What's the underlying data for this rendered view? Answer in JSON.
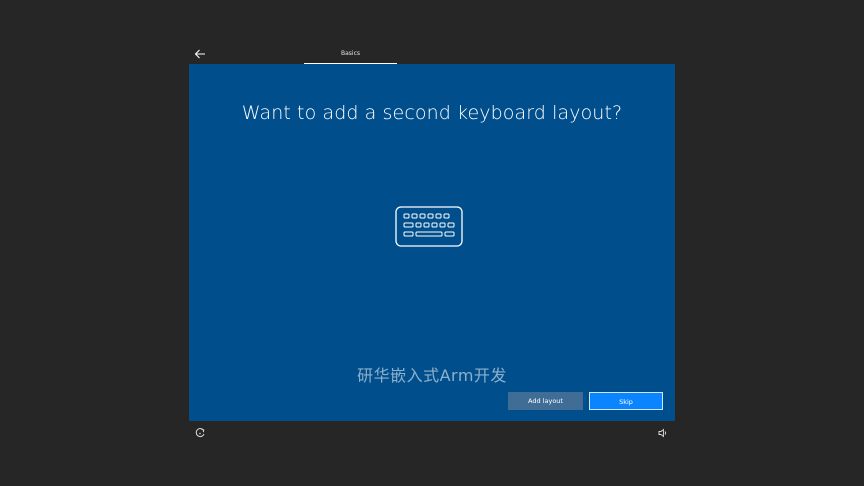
{
  "header": {
    "step_label": "Basics"
  },
  "main": {
    "title": "Want to add a second keyboard layout?",
    "watermark": "研华嵌入式Arm开发"
  },
  "actions": {
    "add_label": "Add layout",
    "skip_label": "Skip"
  },
  "icons": {
    "back": "arrow-left-icon",
    "hero": "keyboard-icon",
    "ease_of_access": "ease-of-access-icon",
    "volume": "volume-icon"
  },
  "colors": {
    "background": "#262626",
    "panel": "#004e8c",
    "primary_button": "#0a84ff",
    "secondary_button": "#3f6d96"
  }
}
